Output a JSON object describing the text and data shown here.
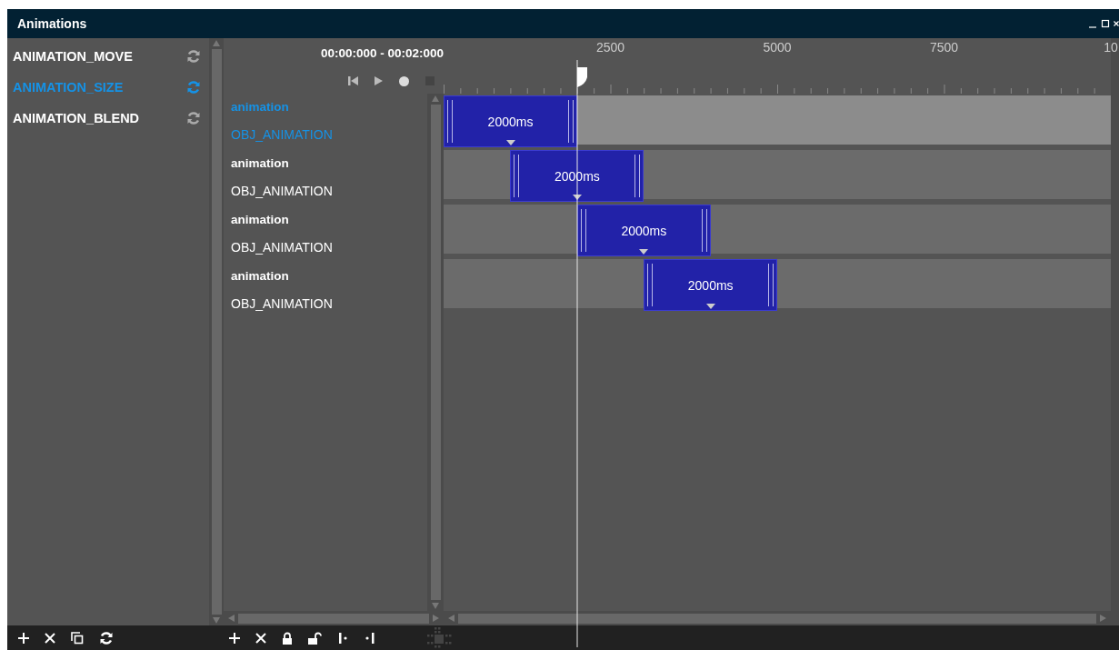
{
  "window": {
    "title": "Animations"
  },
  "animations": [
    {
      "name": "ANIMATION_MOVE",
      "selected": false
    },
    {
      "name": "ANIMATION_SIZE",
      "selected": true
    },
    {
      "name": "ANIMATION_BLEND",
      "selected": false
    }
  ],
  "time_range": "00:00:000 - 00:02:000",
  "ruler_labels": [
    "2500",
    "5000",
    "7500",
    "10"
  ],
  "tracks": [
    {
      "name": "animation",
      "object": "OBJ_ANIMATION",
      "selected": true,
      "clip": "2000ms"
    },
    {
      "name": "animation",
      "object": "OBJ_ANIMATION",
      "selected": false,
      "clip": "2000ms"
    },
    {
      "name": "animation",
      "object": "OBJ_ANIMATION",
      "selected": false,
      "clip": "2000ms"
    },
    {
      "name": "animation",
      "object": "OBJ_ANIMATION",
      "selected": false,
      "clip": "2000ms"
    }
  ]
}
